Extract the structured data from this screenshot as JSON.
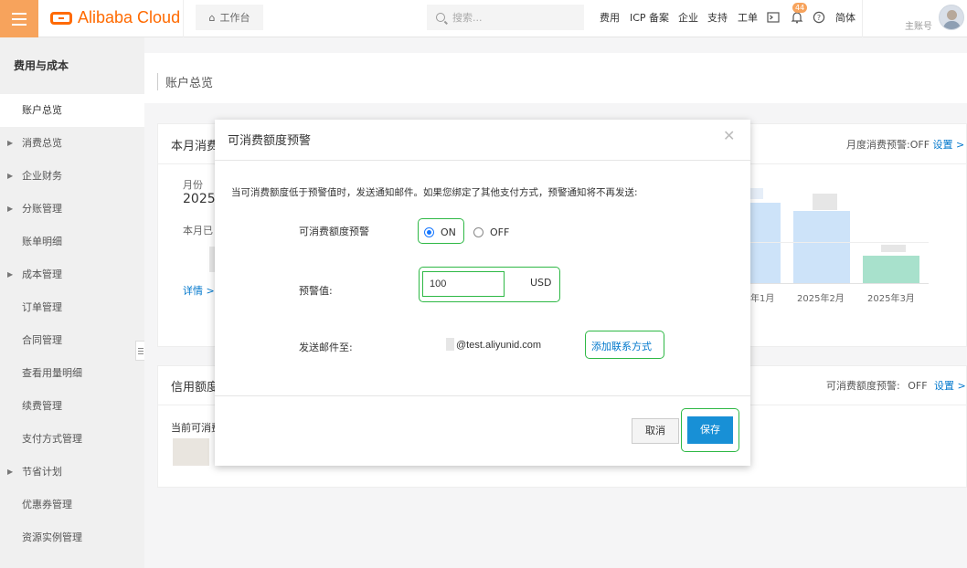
{
  "topbar": {
    "logo": "Alibaba Cloud",
    "workbench": "工作台",
    "search_placeholder": "搜索...",
    "links": [
      "费用",
      "ICP 备案",
      "企业",
      "支持",
      "工单"
    ],
    "notifications_count": "44",
    "language": "简体",
    "account_label": "主账号",
    "accent_color": "#f7a35c"
  },
  "sidebar": {
    "title": "费用与成本",
    "items": [
      {
        "label": "账户总览",
        "active": true,
        "caret": false
      },
      {
        "label": "消费总览",
        "caret": true
      },
      {
        "label": "企业财务",
        "caret": true
      },
      {
        "label": "分账管理",
        "caret": true
      },
      {
        "label": "账单明细",
        "caret": false
      },
      {
        "label": "成本管理",
        "caret": true
      },
      {
        "label": "订单管理",
        "caret": false
      },
      {
        "label": "合同管理",
        "caret": false
      },
      {
        "label": "查看用量明细",
        "caret": false
      },
      {
        "label": "续费管理",
        "caret": false
      },
      {
        "label": "支付方式管理",
        "caret": false
      },
      {
        "label": "节省计划",
        "caret": true
      },
      {
        "label": "优惠券管理",
        "caret": false
      },
      {
        "label": "资源实例管理",
        "caret": false
      }
    ]
  },
  "page": {
    "title": "账户总览",
    "month_panel": {
      "heading": "本月消费",
      "alert_label": "月度消费预警:OFF",
      "settings_link": "设置 >",
      "month_label": "月份",
      "year_partial": "2025",
      "spent_label": "本月已",
      "details_link": "详情 >",
      "axis_labels": [
        "年1月",
        "2025年2月",
        "2025年3月"
      ]
    },
    "credit_panel": {
      "heading": "信用额度",
      "alert_label": "可消费额度预警:",
      "alert_state": "OFF",
      "settings_link": "设置 >",
      "current_label": "当前可消费"
    }
  },
  "modal": {
    "title": "可消费额度预警",
    "description": "当可消费额度低于预警值时，发送通知邮件。如果您绑定了其他支付方式，预警通知将不再发送:",
    "alert_label": "可消费额度预警",
    "option_on": "ON",
    "option_off": "OFF",
    "selected": "ON",
    "threshold_label": "预警值:",
    "threshold_value": "100",
    "threshold_unit": "USD",
    "email_label": "发送邮件至:",
    "email_value": "@test.aliyunid.com",
    "add_contact": "添加联系方式",
    "cancel": "取消",
    "save": "保存"
  }
}
